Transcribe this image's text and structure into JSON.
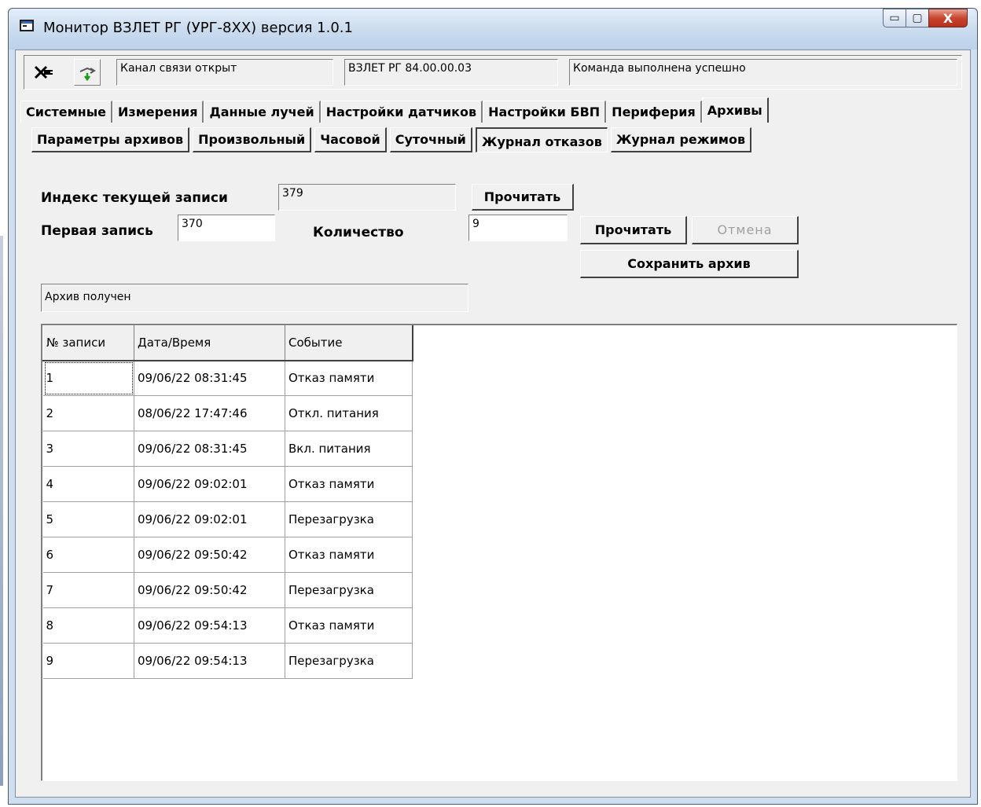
{
  "window": {
    "title": "Монитор ВЗЛЕТ РГ (УРГ-8ХХ) версия 1.0.1",
    "controls": {
      "minimize": "▭",
      "maximize": "▢",
      "close": "X"
    }
  },
  "toolbar": {
    "disconnect_icon": "connect-plug-icon",
    "refresh_icon": "transfer-arrow-icon",
    "channel_status": "Канал связи открыт",
    "device_id": "ВЗЛЕТ РГ 84.00.00.03",
    "command_status": "Команда выполнена успешно"
  },
  "tabs": [
    {
      "label": "Системные",
      "active": false
    },
    {
      "label": "Измерения",
      "active": false
    },
    {
      "label": "Данные лучей",
      "active": false
    },
    {
      "label": "Настройки датчиков",
      "active": false
    },
    {
      "label": "Настройки БВП",
      "active": false
    },
    {
      "label": "Периферия",
      "active": false
    },
    {
      "label": "Архивы",
      "active": true
    }
  ],
  "subtabs": [
    {
      "label": "Параметры архивов",
      "active": false
    },
    {
      "label": "Произвольный",
      "active": false
    },
    {
      "label": "Часовой",
      "active": false
    },
    {
      "label": "Суточный",
      "active": false
    },
    {
      "label": "Журнал отказов",
      "active": true
    },
    {
      "label": "Журнал режимов",
      "active": false
    }
  ],
  "form": {
    "current_index_label": "Индекс текущей записи",
    "current_index_value": "379",
    "read_index_button": "Прочитать",
    "first_record_label": "Первая запись",
    "first_record_value": "370",
    "count_label": "Количество",
    "count_value": "9",
    "read_button": "Прочитать",
    "cancel_button": "Отмена",
    "save_button": "Сохранить архив",
    "status": "Архив получен"
  },
  "table": {
    "columns": [
      "№ записи",
      "Дата/Время",
      "Событие"
    ],
    "rows": [
      [
        "1",
        "09/06/22 08:31:45",
        "Отказ памяти"
      ],
      [
        "2",
        "08/06/22 17:47:46",
        "Откл. питания"
      ],
      [
        "3",
        "09/06/22 08:31:45",
        "Вкл. питания"
      ],
      [
        "4",
        "09/06/22 09:02:01",
        "Отказ памяти"
      ],
      [
        "5",
        "09/06/22 09:02:01",
        "Перезагрузка"
      ],
      [
        "6",
        "09/06/22 09:50:42",
        "Отказ памяти"
      ],
      [
        "7",
        "09/06/22 09:50:42",
        "Перезагрузка"
      ],
      [
        "8",
        "09/06/22 09:54:13",
        "Отказ памяти"
      ],
      [
        "9",
        "09/06/22 09:54:13",
        "Перезагрузка"
      ]
    ]
  }
}
